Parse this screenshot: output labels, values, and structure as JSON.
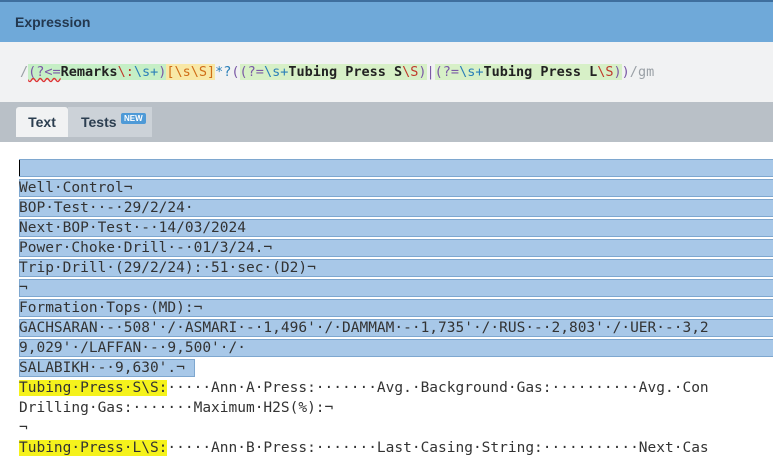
{
  "header": {
    "title": "Expression"
  },
  "expression": {
    "open_slash": "/",
    "lookbehind_open": "(?<=",
    "remarks_text": "Remarks",
    "escape_colon": "\\:",
    "ws_plus_1": "\\s+",
    "group_close_1": ")",
    "char_class": "[\\s\\S]",
    "quant": "*?",
    "group_open_2": "(",
    "lookahead_open_1": "(?=",
    "ws_plus_2": "\\s+",
    "tubing_s_text": "Tubing Press S",
    "escape_s_1": "\\S",
    "lookahead_close_1": ")",
    "alt": "|",
    "lookahead_open_2": "(?=",
    "ws_plus_3": "\\s+",
    "tubing_l_text": "Tubing Press L",
    "escape_s_2": "\\S",
    "lookahead_close_2": ")",
    "group_close_2": ")",
    "close_slash": "/",
    "flags": "gm"
  },
  "tabs": {
    "text_label": "Text",
    "tests_label": "Tests",
    "tests_badge": "NEW"
  },
  "content": {
    "lines": [
      "",
      "Well·Control¬",
      "BOP·Test··-·29/2/24·",
      "Next·BOP·Test·-·14/03/2024",
      "Power·Choke·Drill·-·01/3/24.¬",
      "Trip·Drill·(29/2/24):·51·sec·(D2)¬",
      "¬",
      "Formation·Tops·(MD):¬",
      "GACHSARAN·-·508'·/·ASMARI·-·1,496'·/·DAMMAM·-·1,735'·/·RUS·-·2,803'·/·UER·-·3,2",
      "9,029'·/LAFFAN·-·9,500'·/·",
      "SALABIKH·-·9,630'.¬"
    ],
    "tubing_s_label": "Tubing·Press·S\\S:",
    "tubing_s_rest": "·····Ann·A·Press:·······Avg.·Background·Gas:··········Avg.·Con",
    "drilling_line": "Drilling·Gas:·······Maximum·H2S(%):¬",
    "blank_line": "¬",
    "tubing_l_label": "Tubing·Press·L\\S:",
    "tubing_l_rest": "·····Ann·B·Press:·······Last·Casing·String:···········Next·Cas"
  }
}
